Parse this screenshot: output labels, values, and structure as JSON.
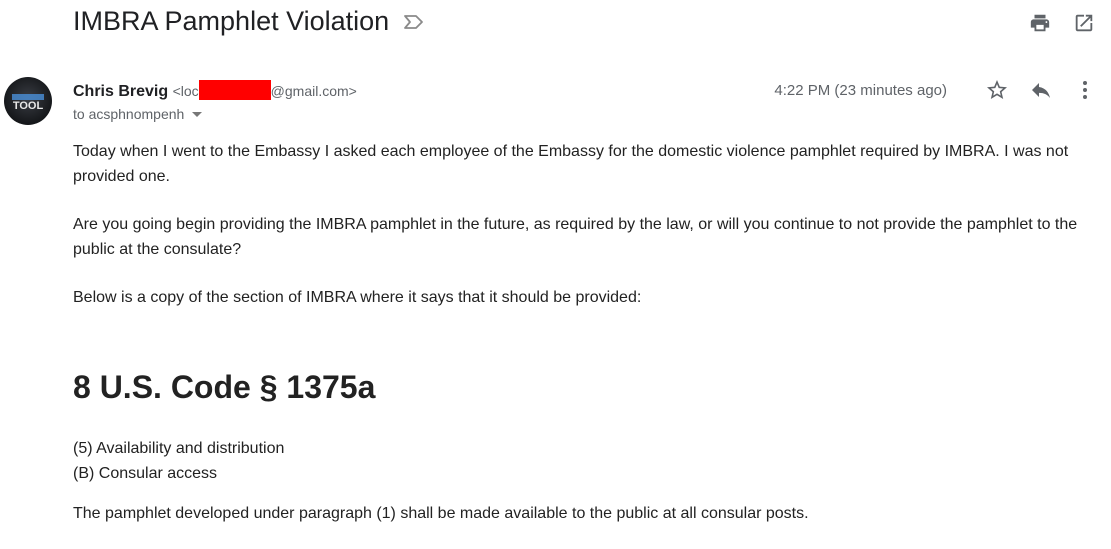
{
  "email": {
    "subject": "IMBRA Pamphlet Violation",
    "sender": {
      "name": "Chris Brevig",
      "email_prefix": "<loc",
      "email_suffix": "@gmail.com>",
      "avatar_text": "TOOL"
    },
    "to_label": "to acsphnompenh",
    "timestamp": "4:22 PM (23 minutes ago)",
    "body": {
      "p1": "Today when I went to the Embassy I asked each employee of the Embassy for the domestic violence pamphlet required by IMBRA.  I was not provided one.",
      "p2": "Are you going begin providing the IMBRA pamphlet in the future, as required by the law, or will you continue to not provide the pamphlet to the public at the consulate?",
      "p3": "Below is a copy of the section of IMBRA where it says that it should be provided:",
      "heading": "8 U.S. Code § 1375a",
      "line1": "(5) Availability and distribution",
      "line2": "(B) Consular access",
      "p4": "The pamphlet developed under paragraph (1) shall be made available to the public at all consular posts."
    }
  },
  "icons": {
    "label": "label-outline-icon",
    "print": "print-icon",
    "new_window": "open-in-new-icon",
    "star": "star-outline-icon",
    "reply": "reply-icon",
    "more": "more-vert-icon",
    "caret": "caret-down-icon"
  },
  "colors": {
    "redaction": "#ff0000",
    "icon_gray": "#5f6368",
    "text": "#222222"
  }
}
